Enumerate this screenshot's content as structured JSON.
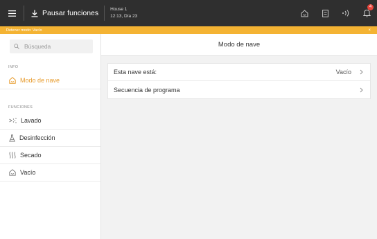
{
  "topbar": {
    "pause_label": "Pausar funciones",
    "house_name": "House 1",
    "house_time": "12:13, Día 23",
    "notifications_count": "4"
  },
  "warning": {
    "text": "Detener modo: Vacío",
    "close": "×"
  },
  "sidebar": {
    "search_placeholder": "Búsqueda",
    "section_info": "INFO",
    "section_functions": "FUNCIONES",
    "items": [
      {
        "label": "Modo de nave",
        "icon": "house-icon",
        "active": true
      },
      {
        "label": "Lavado",
        "icon": "spray-icon"
      },
      {
        "label": "Desinfección",
        "icon": "flask-icon"
      },
      {
        "label": "Secado",
        "icon": "heat-icon"
      },
      {
        "label": "Vacío",
        "icon": "house-outline-icon"
      }
    ]
  },
  "main": {
    "title": "Modo de nave",
    "rows": [
      {
        "label": "Esta nave está:",
        "value": "Vacío"
      },
      {
        "label": "Secuencia de programa",
        "value": ""
      }
    ]
  },
  "colors": {
    "topbar": "#2f2f2f",
    "warning": "#f4b333",
    "accent": "#e79a2a",
    "badge": "#e8463c"
  }
}
